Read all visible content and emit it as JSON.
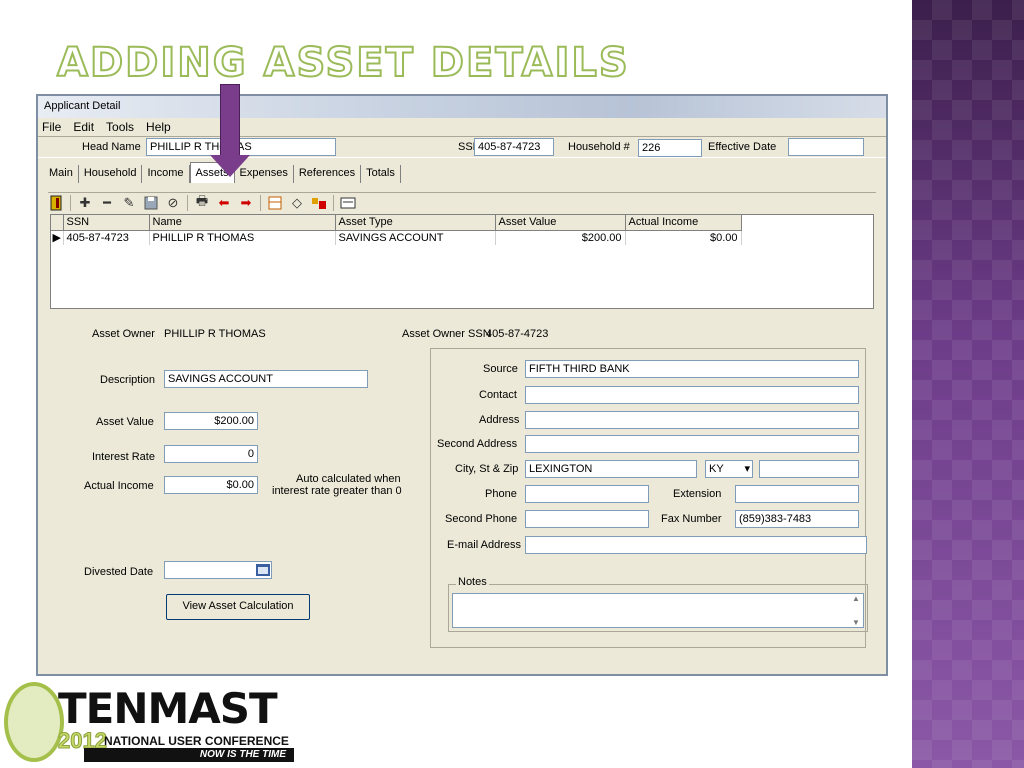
{
  "slide": {
    "title": "ADDING ASSET DETAILS"
  },
  "window": {
    "title": "Applicant Detail",
    "menu": [
      "File",
      "Edit",
      "Tools",
      "Help"
    ]
  },
  "header": {
    "head_name_label": "Head Name",
    "head_name_value": "PHILLIP R THOMAS",
    "ssn_label": "SSN",
    "ssn_value": "405-87-4723",
    "household_label": "Household #",
    "household_value": "226",
    "effective_date_label": "Effective Date",
    "effective_date_value": ""
  },
  "tabs": [
    "Main",
    "Household",
    "Income",
    "Assets",
    "Expenses",
    "References",
    "Totals"
  ],
  "active_tab": "Assets",
  "toolbar_icons": [
    "exit-icon",
    "add-icon",
    "remove-icon",
    "edit-icon",
    "save-icon",
    "cancel-icon",
    "print-icon",
    "previous-icon",
    "next-icon",
    "calculator-icon",
    "eraser-icon",
    "tools-icon",
    "card-icon"
  ],
  "grid": {
    "columns": [
      "SSN",
      "Name",
      "Asset Type",
      "Asset Value",
      "Actual Income"
    ],
    "rows": [
      [
        "405-87-4723",
        "PHILLIP R THOMAS",
        "SAVINGS ACCOUNT",
        "$200.00",
        "$0.00"
      ]
    ]
  },
  "detail": {
    "asset_owner_label": "Asset Owner",
    "asset_owner_value": "PHILLIP R THOMAS",
    "asset_owner_ssn_label": "Asset Owner SSN",
    "asset_owner_ssn_value": "405-87-4723",
    "description_label": "Description",
    "description_value": "SAVINGS ACCOUNT",
    "asset_value_label": "Asset Value",
    "asset_value_value": "$200.00",
    "interest_rate_label": "Interest Rate",
    "interest_rate_value": "0",
    "actual_income_label": "Actual Income",
    "actual_income_value": "$0.00",
    "auto_calc_note_line1": "Auto calculated when",
    "auto_calc_note_line2": "interest rate greater than 0",
    "divested_date_label": "Divested Date",
    "divested_date_value": "",
    "view_calc_button": "View Asset Calculation"
  },
  "institution": {
    "source_label": "Source",
    "source_value": "FIFTH THIRD BANK",
    "contact_label": "Contact",
    "contact_value": "",
    "address_label": "Address",
    "address_value": "",
    "second_address_label": "Second Address",
    "second_address_value": "",
    "city_label": "City, St & Zip",
    "city_value": "LEXINGTON",
    "state_value": "KY",
    "zip_value": "",
    "phone_label": "Phone",
    "phone_value": "",
    "extension_label": "Extension",
    "extension_value": "",
    "second_phone_label": "Second Phone",
    "second_phone_value": "",
    "fax_label": "Fax Number",
    "fax_value": "(859)383-7483",
    "email_label": "E-mail Address",
    "email_value": "",
    "notes_label": "Notes",
    "notes_value": ""
  },
  "logo": {
    "brand": "TENMAST",
    "year": "2012",
    "subtitle": "NATIONAL USER CONFERENCE",
    "tagline": "NOW IS THE TIME"
  },
  "colors": {
    "title_outline": "#9bbb59",
    "arrow": "#7a3d8c",
    "band": "#6b3a85"
  }
}
